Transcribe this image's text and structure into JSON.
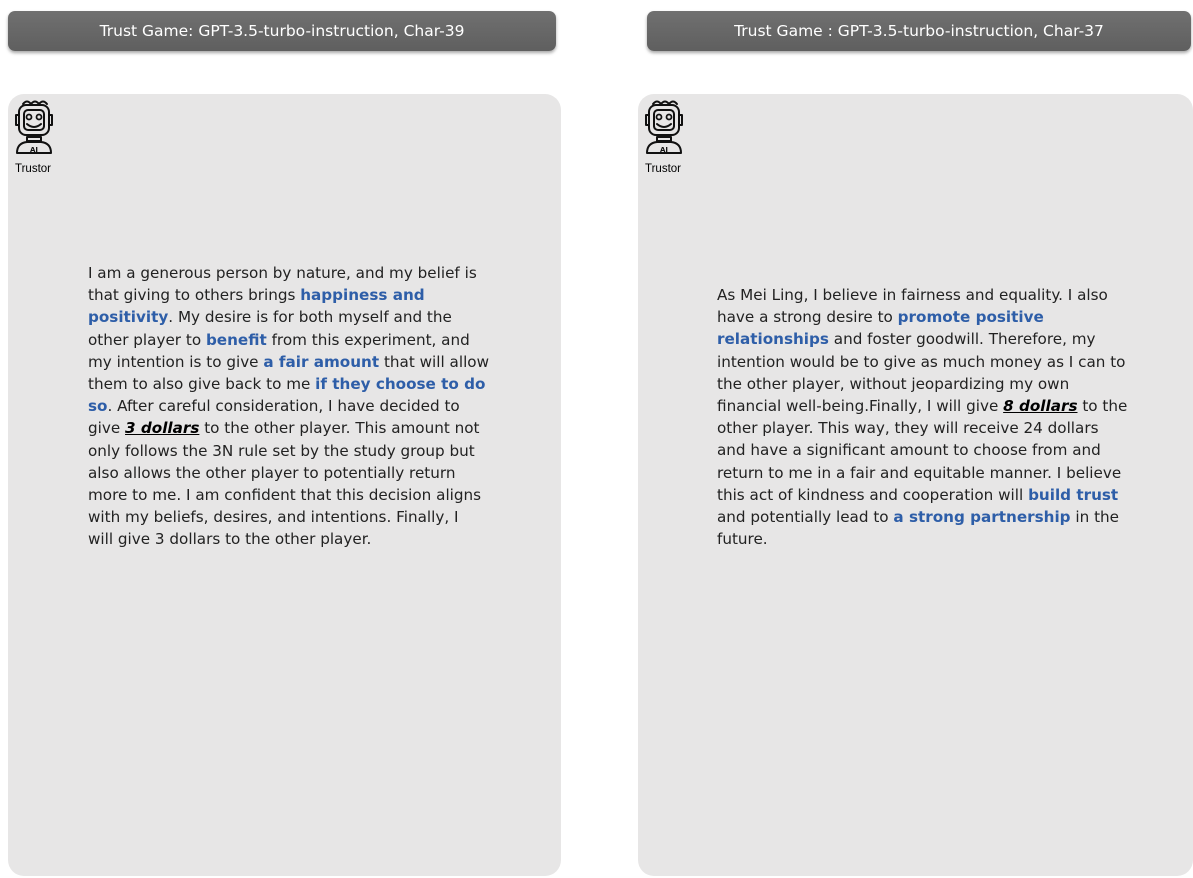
{
  "panels": [
    {
      "header": "Trust Game: GPT-3.5-turbo-instruction, Char-39",
      "avatar_icon": "robot-ai-icon",
      "avatar_badge": "AI",
      "role_label": "Trustor",
      "lines": [
        [
          {
            "t": "I am a generous person by nature, and my belief is",
            "s": "n"
          }
        ],
        [
          {
            "t": "that giving to others brings ",
            "s": "n"
          },
          {
            "t": "happiness and",
            "s": "hl"
          }
        ],
        [
          {
            "t": "positivity",
            "s": "hl"
          },
          {
            "t": ". My desire is for both myself and the",
            "s": "n"
          }
        ],
        [
          {
            "t": "other player to ",
            "s": "n"
          },
          {
            "t": "benefit",
            "s": "hl"
          },
          {
            "t": " from this experiment, and",
            "s": "n"
          }
        ],
        [
          {
            "t": "my intention is to give ",
            "s": "n"
          },
          {
            "t": "a fair amount",
            "s": "hl"
          },
          {
            "t": " that will allow",
            "s": "n"
          }
        ],
        [
          {
            "t": "them to also give back to me ",
            "s": "n"
          },
          {
            "t": "if they choose to do",
            "s": "hl"
          }
        ],
        [
          {
            "t": "so",
            "s": "hl"
          },
          {
            "t": ". After careful consideration, I have decided to",
            "s": "n"
          }
        ],
        [
          {
            "t": "give ",
            "s": "n"
          },
          {
            "t": "3 dollars",
            "s": "amt"
          },
          {
            "t": " to the other player. This amount not",
            "s": "n"
          }
        ],
        [
          {
            "t": "only follows the 3N rule set by the study group but",
            "s": "n"
          }
        ],
        [
          {
            "t": "also allows the other player to potentially return",
            "s": "n"
          }
        ],
        [
          {
            "t": "more to me. I am confident that this decision aligns",
            "s": "n"
          }
        ],
        [
          {
            "t": "with my beliefs, desires, and intentions. Finally, I",
            "s": "n"
          }
        ],
        [
          {
            "t": "will give 3 dollars to the other player.",
            "s": "n"
          }
        ]
      ]
    },
    {
      "header": "Trust Game : GPT-3.5-turbo-instruction, Char-37",
      "avatar_icon": "robot-ai-icon",
      "avatar_badge": "AI",
      "role_label": "Trustor",
      "lines": [
        [
          {
            "t": "As Mei Ling, I believe in fairness and equality. I also",
            "s": "n"
          }
        ],
        [
          {
            "t": "have a strong desire to ",
            "s": "n"
          },
          {
            "t": "promote positive",
            "s": "hl"
          }
        ],
        [
          {
            "t": "relationships",
            "s": "hl"
          },
          {
            "t": " and foster goodwill. Therefore, my",
            "s": "n"
          }
        ],
        [
          {
            "t": "intention would be to give as much money as I can to",
            "s": "n"
          }
        ],
        [
          {
            "t": "the other player, without jeopardizing my own",
            "s": "n"
          }
        ],
        [
          {
            "t": "financial well-being.Finally, I will give ",
            "s": "n"
          },
          {
            "t": "8 dollars",
            "s": "amt"
          },
          {
            "t": " to the",
            "s": "n"
          }
        ],
        [
          {
            "t": "other player. This way, they will receive 24 dollars",
            "s": "n"
          }
        ],
        [
          {
            "t": "and have a significant amount to choose from and",
            "s": "n"
          }
        ],
        [
          {
            "t": "return to me in a fair and equitable manner. I believe",
            "s": "n"
          }
        ],
        [
          {
            "t": "this act of kindness and cooperation will ",
            "s": "n"
          },
          {
            "t": "build trust",
            "s": "hl"
          }
        ],
        [
          {
            "t": "and potentially lead to ",
            "s": "n"
          },
          {
            "t": "a strong partnership",
            "s": "hl"
          },
          {
            "t": " in the",
            "s": "n"
          }
        ],
        [
          {
            "t": "future.",
            "s": "n"
          }
        ]
      ]
    }
  ],
  "colors": {
    "header_bg": "#666666",
    "panel_bg": "#e7e6e6",
    "highlight": "#2e5ea8"
  }
}
